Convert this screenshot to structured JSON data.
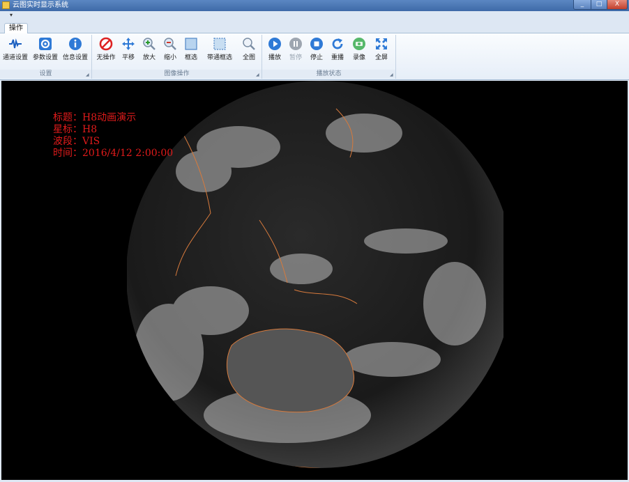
{
  "window": {
    "title": "云图实时显示系统",
    "minimize_glyph": "_",
    "maximize_glyph": "□",
    "close_glyph": "X"
  },
  "qat": {
    "arrow": "▾"
  },
  "tabs": [
    {
      "label": "操作",
      "active": true
    }
  ],
  "ribbon": {
    "groups": [
      {
        "label": "设置",
        "buttons": [
          {
            "label": "通道设置",
            "icon": "channel-wave-icon"
          },
          {
            "label": "参数设置",
            "icon": "gear-icon"
          },
          {
            "label": "信息设置",
            "icon": "info-icon"
          }
        ]
      },
      {
        "label": "图像操作",
        "buttons": [
          {
            "label": "无操作",
            "icon": "no-operation-icon"
          },
          {
            "label": "平移",
            "icon": "pan-arrows-icon"
          },
          {
            "label": "放大",
            "icon": "zoom-in-icon"
          },
          {
            "label": "缩小",
            "icon": "zoom-out-icon"
          },
          {
            "label": "框选",
            "icon": "box-select-icon"
          },
          {
            "label": "带通框选",
            "icon": "bandpass-box-select-icon"
          },
          {
            "label": "全图",
            "icon": "full-view-magnifier-icon"
          }
        ]
      },
      {
        "label": "播放状态",
        "buttons": [
          {
            "label": "播放",
            "icon": "play-icon",
            "enabled": true
          },
          {
            "label": "暂停",
            "icon": "pause-icon",
            "enabled": false
          },
          {
            "label": "停止",
            "icon": "stop-icon",
            "enabled": true
          },
          {
            "label": "重播",
            "icon": "replay-icon",
            "enabled": true
          },
          {
            "label": "录像",
            "icon": "record-icon",
            "enabled": true
          },
          {
            "label": "全屏",
            "icon": "fullscreen-icon",
            "enabled": true
          }
        ]
      }
    ]
  },
  "overlay": {
    "title_line": "标题：H8动画演示",
    "satellite_line": "星标：H8",
    "band_line": "波段：VIS",
    "time_line": "时间：2016/4/12 2:00:00",
    "text_color": "#e21b1b"
  },
  "colors": {
    "accent": "#3e6aa8",
    "coastline": "#d77a3c",
    "canvas": "#000000"
  }
}
